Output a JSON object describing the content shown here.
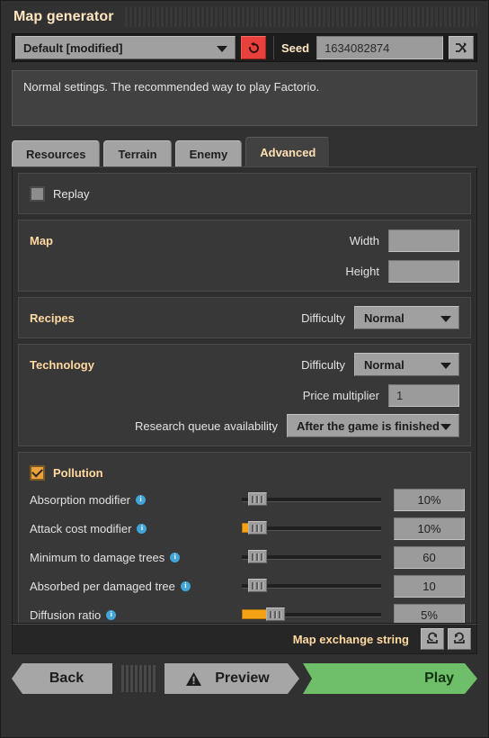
{
  "window": {
    "title": "Map generator"
  },
  "topbar": {
    "preset": "Default [modified]",
    "reset_icon": "reset-arrow-icon",
    "seed_label": "Seed",
    "seed_value": "1634082874",
    "shuffle_icon": "shuffle-icon"
  },
  "description": "Normal settings. The recommended way to play Factorio.",
  "tabs": [
    {
      "label": "Resources",
      "active": false
    },
    {
      "label": "Terrain",
      "active": false
    },
    {
      "label": "Enemy",
      "active": false
    },
    {
      "label": "Advanced",
      "active": true
    }
  ],
  "replay": {
    "label": "Replay",
    "checked": false
  },
  "map": {
    "title": "Map",
    "width_label": "Width",
    "width_value": "",
    "height_label": "Height",
    "height_value": ""
  },
  "recipes": {
    "title": "Recipes",
    "difficulty_label": "Difficulty",
    "difficulty_value": "Normal"
  },
  "technology": {
    "title": "Technology",
    "difficulty_label": "Difficulty",
    "difficulty_value": "Normal",
    "price_multiplier_label": "Price multiplier",
    "price_multiplier_value": "1",
    "research_queue_label": "Research queue availability",
    "research_queue_value": "After the game is finished"
  },
  "pollution": {
    "title": "Pollution",
    "checked": true,
    "sliders": [
      {
        "label": "Absorption modifier",
        "value": "10%",
        "percent": 5,
        "filled": false
      },
      {
        "label": "Attack cost modifier",
        "value": "10%",
        "percent": 5,
        "filled": true
      },
      {
        "label": "Minimum to damage trees",
        "value": "60",
        "percent": 5,
        "filled": false
      },
      {
        "label": "Absorbed per damaged tree",
        "value": "10",
        "percent": 5,
        "filled": false
      },
      {
        "label": "Diffusion ratio",
        "value": "5%",
        "percent": 20,
        "filled": true
      }
    ]
  },
  "exchange": {
    "label": "Map exchange string",
    "import_icon": "import-arrow-icon",
    "export_icon": "export-arrow-icon"
  },
  "footer": {
    "back_label": "Back",
    "preview_label": "Preview",
    "preview_icon": "warning-triangle-icon",
    "play_label": "Play"
  },
  "colors": {
    "accent_orange": "#ffd9a0",
    "reset_red": "#e8413c",
    "play_green": "#6fbf6a",
    "slider_fill": "#f4a316",
    "info_blue": "#41a5d8"
  }
}
